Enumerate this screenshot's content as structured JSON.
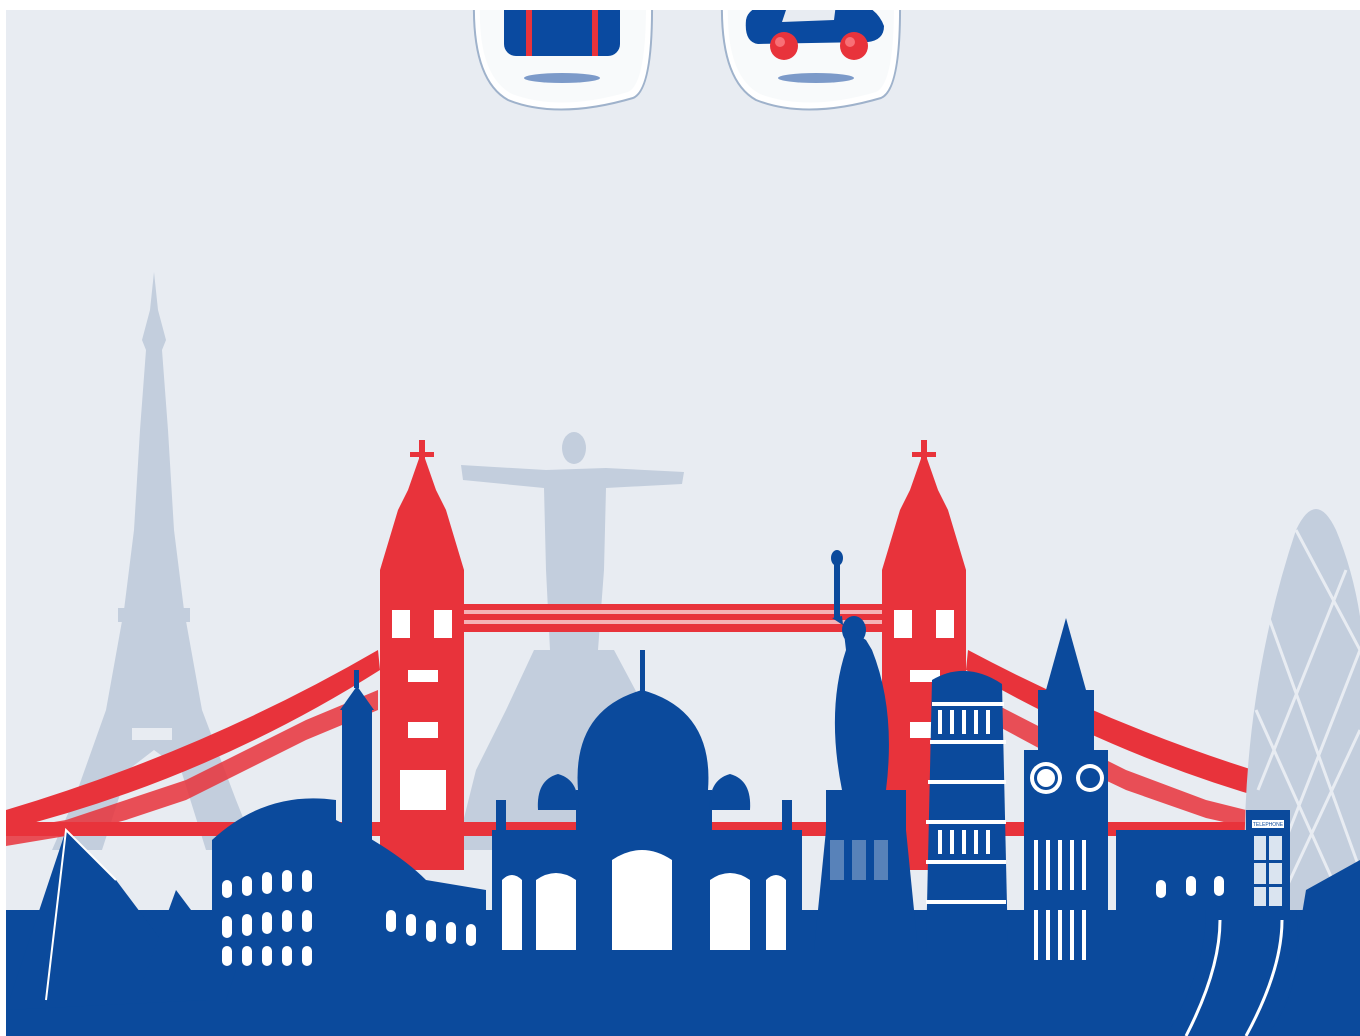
{
  "icons": [
    {
      "name": "luggage-icon",
      "color": "#0a4aa0",
      "accent": "#e8333b"
    },
    {
      "name": "car-icon",
      "color": "#0a4aa0",
      "accent": "#e8333b"
    }
  ],
  "colors": {
    "background": "#e8ecf2",
    "primary_blue": "#0b4a9c",
    "accent_red": "#e8333b",
    "faded_blue": "#c3cedd"
  },
  "landmarks": [
    "eiffel-tower",
    "christ-the-redeemer",
    "tower-bridge",
    "colosseum",
    "taj-mahal",
    "statue-of-liberty",
    "leaning-tower-of-pisa",
    "big-ben",
    "great-wall",
    "telephone-box",
    "gherkin",
    "pyramids"
  ],
  "telephone_sign": "TELEPHONE"
}
